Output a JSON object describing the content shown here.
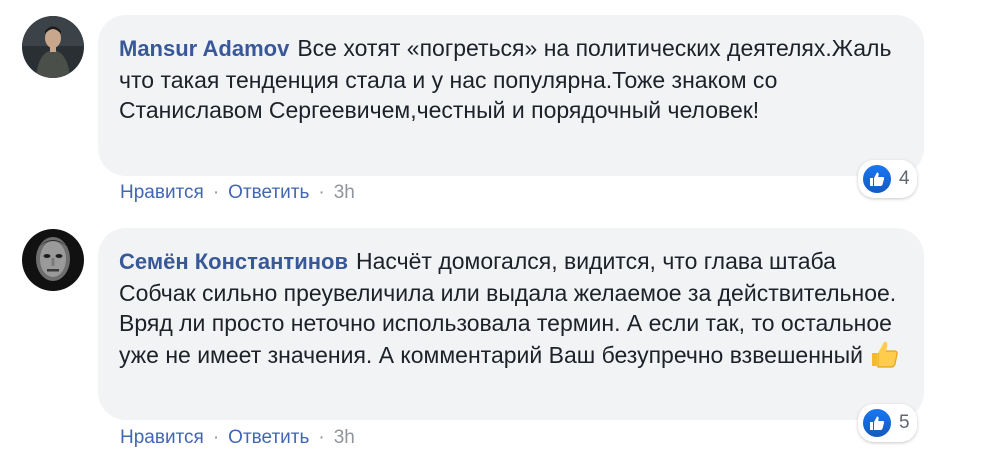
{
  "comments": [
    {
      "author": "Mansur Adamov",
      "text": "Все хотят «погреться» на политических деятелях.Жаль что такая тенденция стала и у нас популярна.Тоже знаком со Станиславом Сергеевичем,честный и порядочный человек!",
      "reaction_icon": "like-icon",
      "reaction_count": "4",
      "like_label": "Нравится",
      "reply_label": "Ответить",
      "separator": "·",
      "time": "3h"
    },
    {
      "author": "Семён Константинов",
      "text": "Насчёт домогался, видится, что глава штаба Собчак сильно преувеличила или выдала желаемое за действительное. Вряд ли просто неточно использовала термин. А если так, то остальное уже не имеет значения. А комментарий Ваш безупречно взвешенный",
      "emoji": "thumbs-up-emoji",
      "reaction_icon": "like-icon",
      "reaction_count": "5",
      "like_label": "Нравится",
      "reply_label": "Ответить",
      "separator": "·",
      "time": "3h"
    }
  ],
  "colors": {
    "author": "#385898",
    "bubble": "#f2f3f5",
    "link": "#4267b2",
    "like_badge": "#1877f2"
  }
}
